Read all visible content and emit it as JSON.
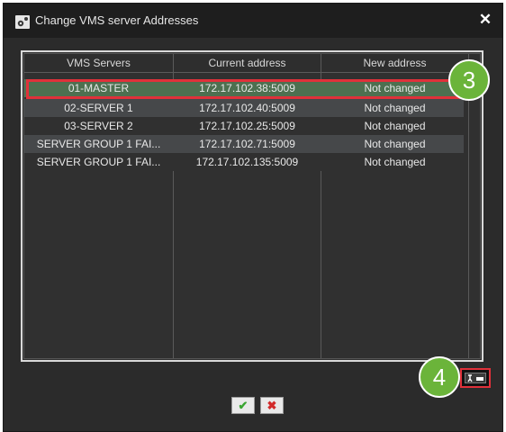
{
  "window": {
    "title": "Change VMS server Addresses",
    "close_label": "✕"
  },
  "table": {
    "headers": [
      "VMS Servers",
      "Current address",
      "New address"
    ],
    "rows": [
      {
        "server": "01-MASTER",
        "current": "172.17.102.38:5009",
        "new": "Not changed",
        "selected": true
      },
      {
        "server": "02-SERVER 1",
        "current": "172.17.102.40:5009",
        "new": "Not changed"
      },
      {
        "server": "03-SERVER 2",
        "current": "172.17.102.25:5009",
        "new": "Not changed"
      },
      {
        "server": "SERVER GROUP 1 FAI...",
        "current": "172.17.102.71:5009",
        "new": "Not changed"
      },
      {
        "server": "SERVER GROUP 1 FAI...",
        "current": "172.17.102.135:5009",
        "new": "Not changed"
      }
    ]
  },
  "callouts": {
    "step3": "3",
    "step4": "4"
  },
  "buttons": {
    "ok_label": "✔",
    "cancel_label": "✖"
  },
  "colors": {
    "highlight": "#e0313a",
    "badge": "#6bb43a",
    "selected_row": "#4d7050"
  }
}
